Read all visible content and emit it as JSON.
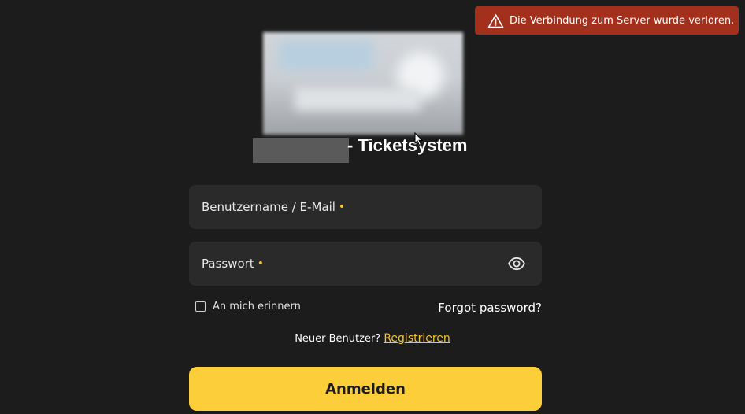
{
  "toast": {
    "message": "Die Verbindung zum Server wurde verloren.",
    "icon": "warning-icon",
    "color": "#a3301c"
  },
  "header": {
    "title_suffix": "- Ticketsystem"
  },
  "form": {
    "username_label": "Benutzername / E-Mail",
    "password_label": "Passwort",
    "required_marker": "•",
    "remember_label": "An mich erinnern",
    "forgot_label": "Forgot password?",
    "register_prompt": "Neuer Benutzer?",
    "register_link": "Registrieren",
    "submit_label": "Anmelden"
  },
  "colors": {
    "background": "#1c1c1c",
    "field": "#2a2a2a",
    "accent": "#fccf3a"
  }
}
